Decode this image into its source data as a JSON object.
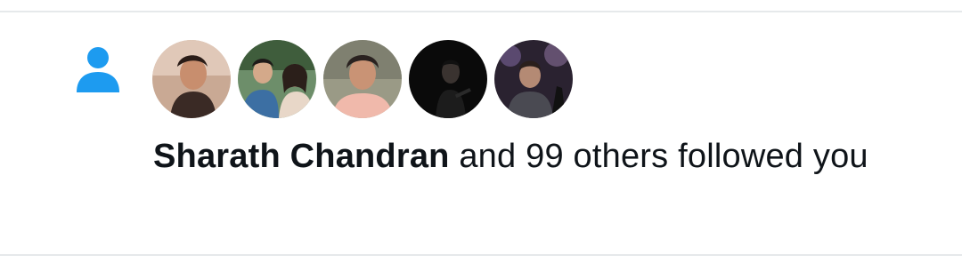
{
  "notification": {
    "type_icon": "person-icon",
    "accent_color": "#1d9bf0",
    "avatar_count": 5,
    "avatars": [
      {
        "icon": "avatar-photo"
      },
      {
        "icon": "avatar-photo"
      },
      {
        "icon": "avatar-photo"
      },
      {
        "icon": "avatar-photo"
      },
      {
        "icon": "avatar-photo"
      }
    ],
    "actor_name": "Sharath Chandran",
    "message_rest": " and 99 others followed you"
  }
}
